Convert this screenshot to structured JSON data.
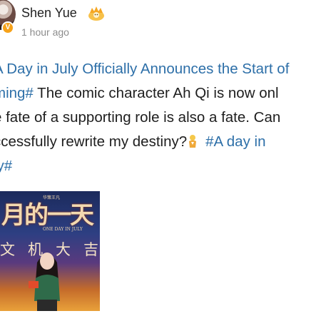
{
  "user": {
    "name": "Shen Yue",
    "verified_mark": "V",
    "badge_icon": "crown-icon",
    "time": "1 hour ago"
  },
  "post": {
    "line1": "A Day in July Officially Announces the Start of",
    "line2_hashtag": "ming#",
    "line2_rest": " The comic character Ah Qi is now onl",
    "line3": "e fate of a supporting role is also a fate. Can",
    "line4_text": "ccessfully rewrite my destiny?",
    "line4_emoji_icon": "praying-figure-emoji",
    "line4_hashtag": "#A day in",
    "line5_hashtag": "ly#",
    "link_color": "#2d6fa8"
  },
  "image": {
    "title": "月的一天",
    "small_text": "华策王凡",
    "subtitle": "ONE DAY IN JULY",
    "blessing": [
      "文",
      "机",
      "大",
      "吉"
    ]
  }
}
